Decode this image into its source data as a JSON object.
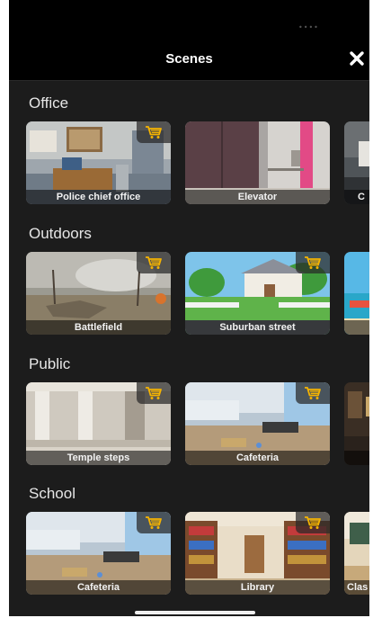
{
  "status_bar": {
    "dots": "••••"
  },
  "header": {
    "title": "Scenes",
    "close_icon": "close-icon"
  },
  "sections": [
    {
      "title": "Office",
      "cards": [
        {
          "label": "Police chief office",
          "locked": true
        },
        {
          "label": "Elevator",
          "locked": false
        },
        {
          "label": "C",
          "locked": false
        }
      ]
    },
    {
      "title": "Outdoors",
      "cards": [
        {
          "label": "Battlefield",
          "locked": true
        },
        {
          "label": "Suburban street",
          "locked": true
        },
        {
          "label": "",
          "locked": false
        }
      ]
    },
    {
      "title": "Public",
      "cards": [
        {
          "label": "Temple steps",
          "locked": true
        },
        {
          "label": "Cafeteria",
          "locked": true
        },
        {
          "label": "",
          "locked": false
        }
      ]
    },
    {
      "title": "School",
      "cards": [
        {
          "label": "Cafeteria",
          "locked": true
        },
        {
          "label": "Library",
          "locked": true
        },
        {
          "label": "Clas",
          "locked": false
        }
      ]
    }
  ],
  "colors": {
    "background": "#1c1c1c",
    "header": "#000000",
    "cart_icon": "#f5b301"
  }
}
